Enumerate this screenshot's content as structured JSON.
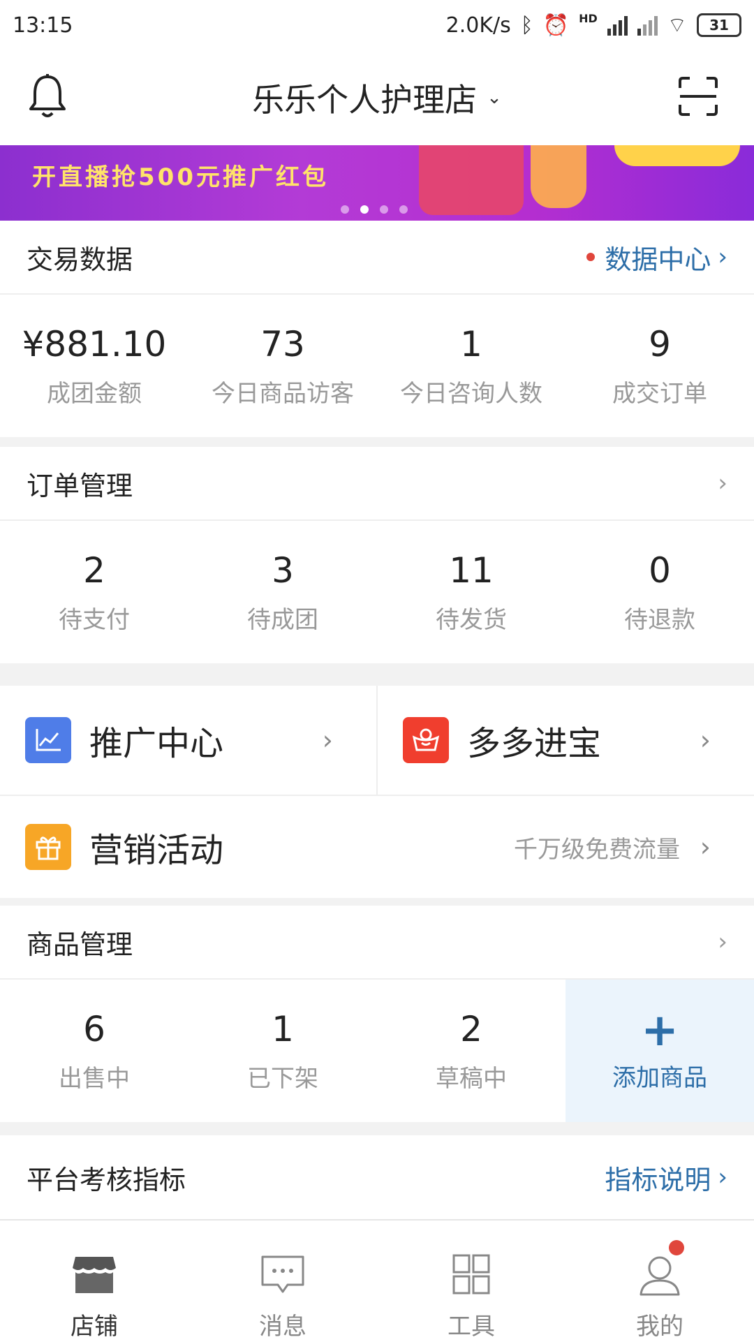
{
  "status_bar": {
    "time": "13:15",
    "net_speed": "2.0K/s",
    "hd_label": "HD",
    "battery": "31"
  },
  "header": {
    "shop_name": "乐乐个人护理店",
    "dropdown_icon": "chevron-down-icon",
    "left_icon": "bell-icon",
    "right_icon": "scan-icon"
  },
  "banner": {
    "text": "开直播抢500元推广红包",
    "slide_count": 4,
    "active_slide": 1
  },
  "trade": {
    "title": "交易数据",
    "link": "数据中心",
    "stats": [
      {
        "value": "¥881.10",
        "label": "成团金额"
      },
      {
        "value": "73",
        "label": "今日商品访客"
      },
      {
        "value": "1",
        "label": "今日咨询人数"
      },
      {
        "value": "9",
        "label": "成交订单"
      }
    ]
  },
  "orders": {
    "title": "订单管理",
    "stats": [
      {
        "value": "2",
        "label": "待支付"
      },
      {
        "value": "3",
        "label": "待成团"
      },
      {
        "value": "11",
        "label": "待发货"
      },
      {
        "value": "0",
        "label": "待退款"
      }
    ]
  },
  "promo": {
    "promotion_center": "推广中心",
    "duoduo_jinbao": "多多进宝",
    "marketing": "营销活动",
    "marketing_sub": "千万级免费流量"
  },
  "goods": {
    "title": "商品管理",
    "stats": [
      {
        "value": "6",
        "label": "出售中"
      },
      {
        "value": "1",
        "label": "已下架"
      },
      {
        "value": "2",
        "label": "草稿中"
      }
    ],
    "add_label": "添加商品"
  },
  "metrics": {
    "title": "平台考核指标",
    "link": "指标说明"
  },
  "tabs": [
    {
      "label": "店铺",
      "icon": "store-icon"
    },
    {
      "label": "消息",
      "icon": "message-icon"
    },
    {
      "label": "工具",
      "icon": "grid-icon"
    },
    {
      "label": "我的",
      "icon": "person-icon"
    }
  ],
  "colors": {
    "accent": "#2d6ea8",
    "badge": "#e0463c",
    "promo_icon": "#4f7de8",
    "jinbao_icon": "#f03e2e",
    "marketing_icon": "#f7a626"
  }
}
